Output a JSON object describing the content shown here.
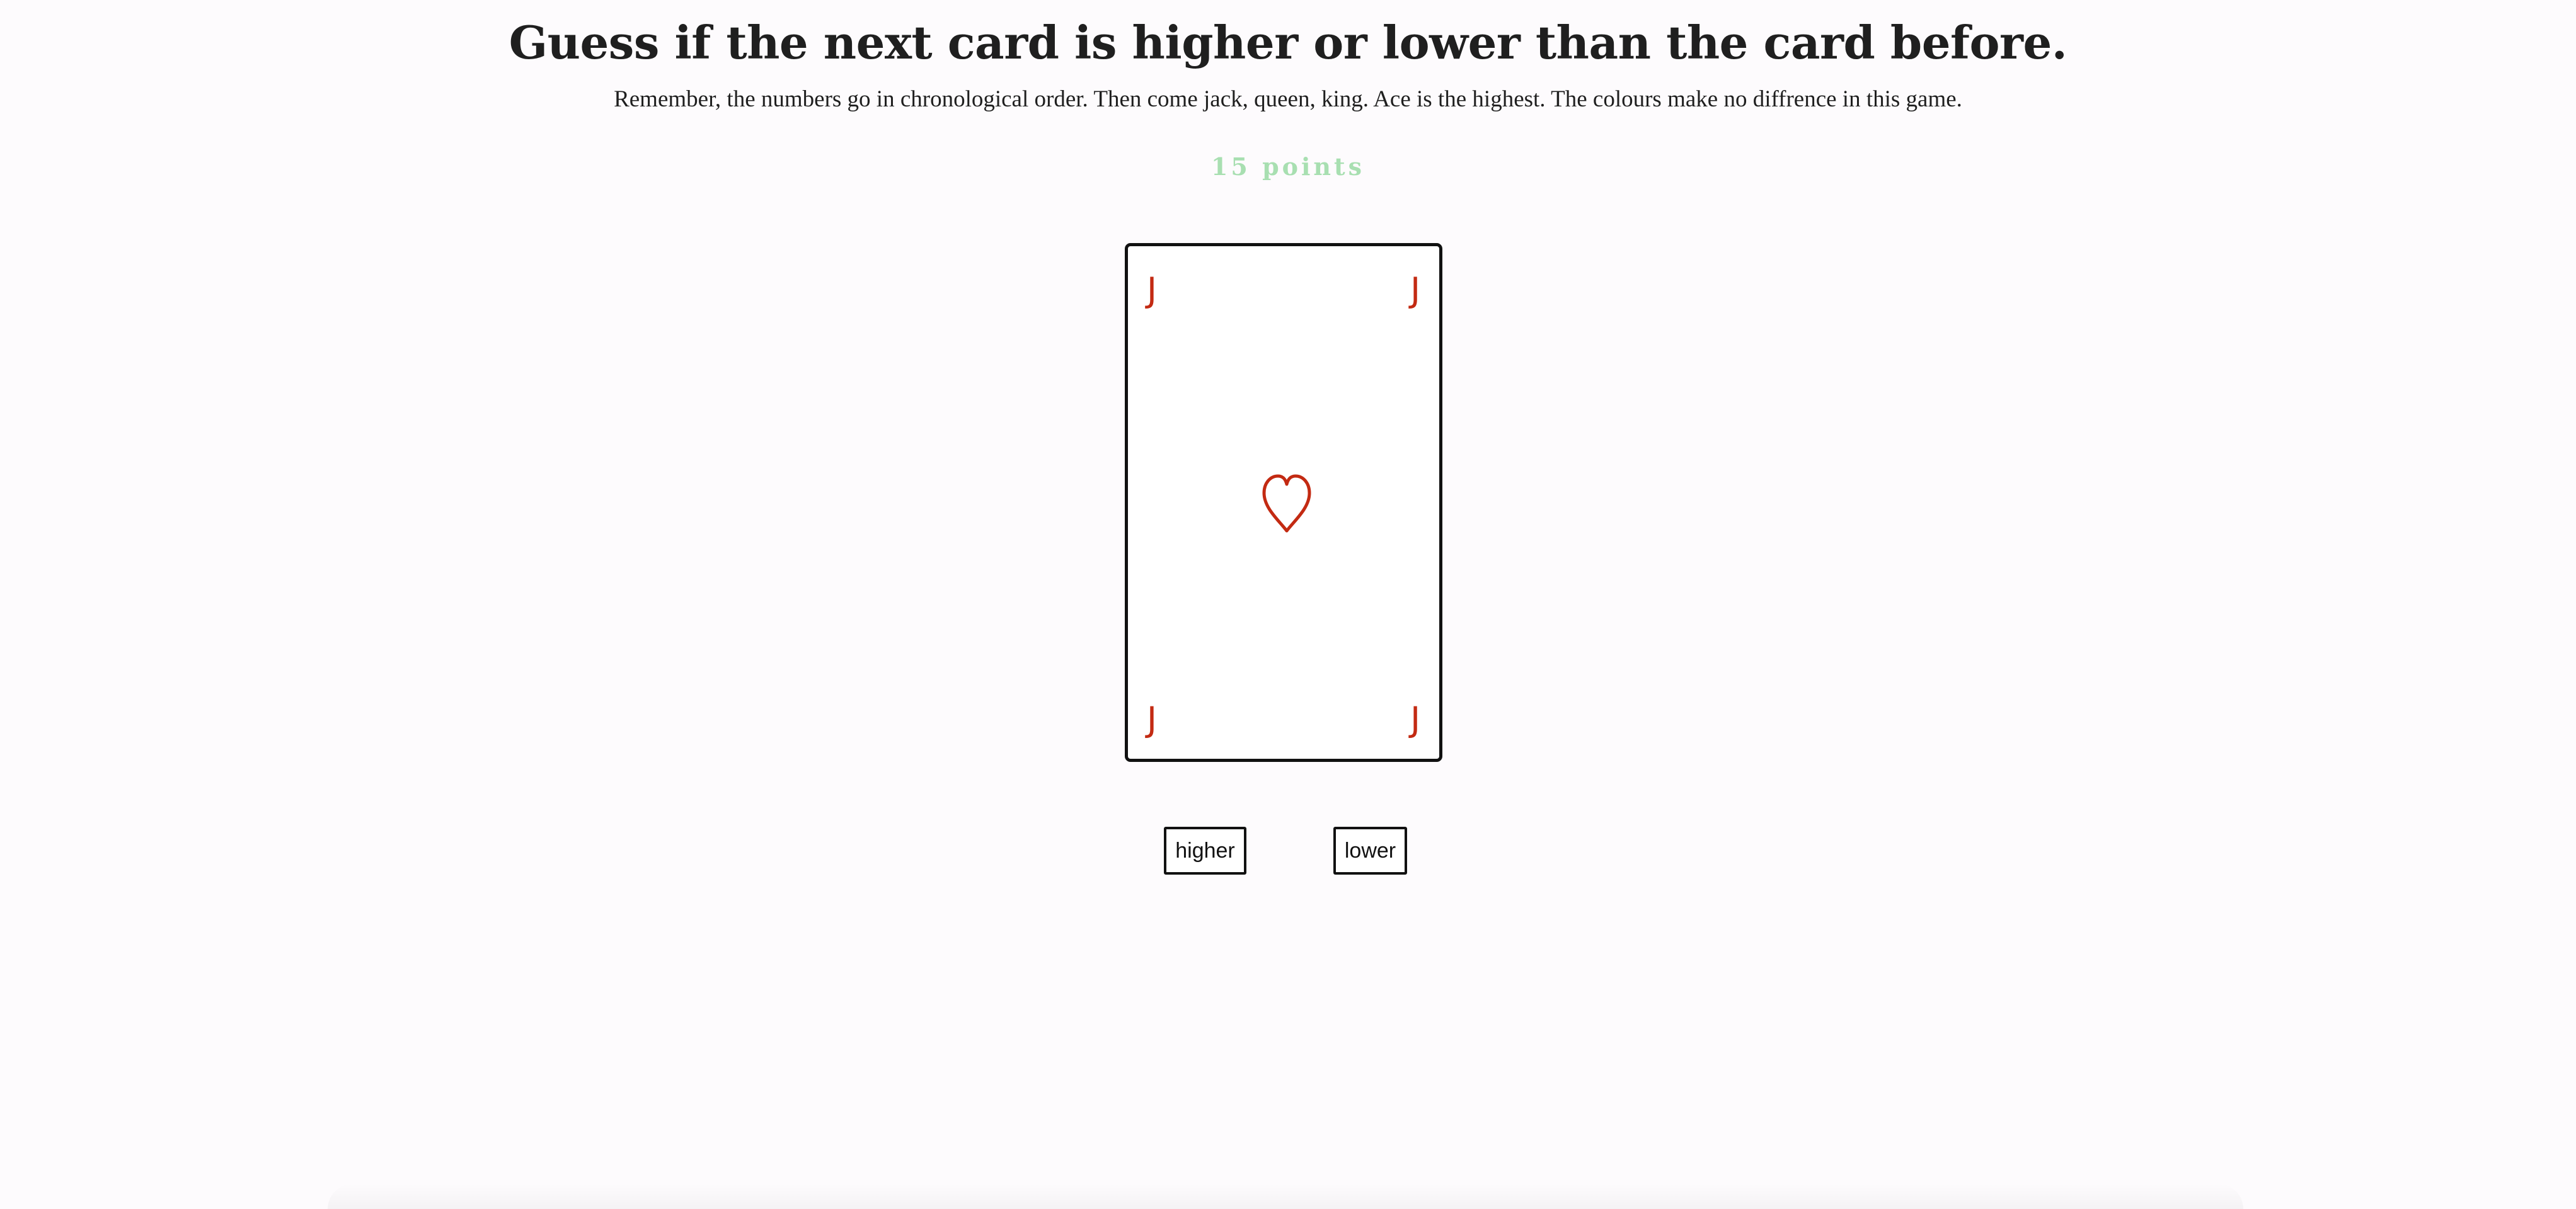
{
  "header": {
    "title": "Guess if the next card is higher or lower than the card before.",
    "instructions": "Remember, the numbers go in chronological order. Then come jack, queen, king. Ace is the highest. The colours make no diffrence in this game."
  },
  "score": {
    "text": "15 points",
    "color": "#a8dfb1"
  },
  "card": {
    "rank": "J",
    "suit": "hearts",
    "suit_icon": "heart-outline-icon",
    "color": "#c32a12"
  },
  "controls": {
    "higher_label": "higher",
    "lower_label": "lower"
  }
}
